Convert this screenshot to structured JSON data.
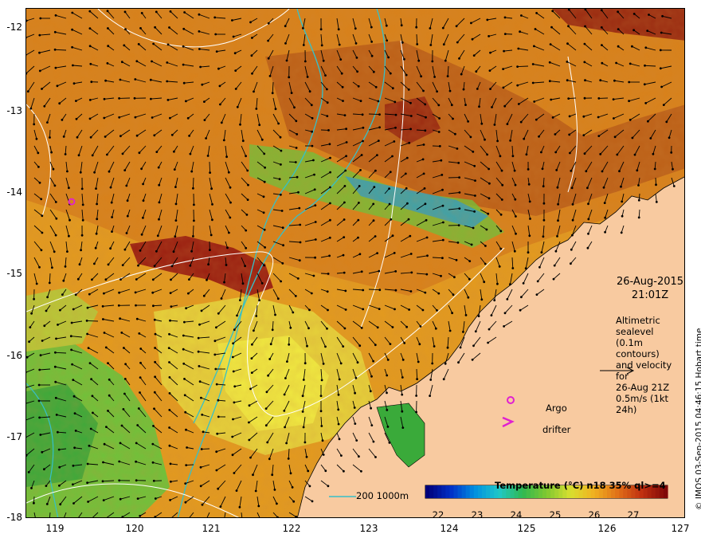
{
  "map": {
    "y_axis_labels": [
      "-12",
      "-13",
      "-14",
      "-15",
      "-16",
      "-17",
      "-18"
    ],
    "x_axis_labels": [
      "119",
      "120",
      "121",
      "122",
      "123",
      "124",
      "125",
      "126",
      "127"
    ],
    "lon_range": [
      118.6,
      127
    ],
    "lat_range": [
      -18,
      -11.75
    ]
  },
  "overlay": {
    "date": "26-Aug-2015",
    "time": "21:01Z",
    "altimetry_lines": [
      "Altimetric sealevel",
      "(0.1m contours)",
      "and velocity for",
      "26-Aug 21Z",
      "0.5m/s (1kt 24h)"
    ],
    "argo_label": "Argo",
    "drifter_label": "drifter",
    "depth_label": "200  1000m",
    "credit": "© IMOS 03-Sep-2015 04:46:15 Hobart time"
  },
  "legend": {
    "title": "Temperature (°C) n18 35% ql>=4",
    "ticks": [
      "22",
      "23",
      "24",
      "25",
      "26",
      "27"
    ],
    "range": [
      21.7,
      27.9
    ]
  },
  "colors": {
    "land": "#f8caa0",
    "warm": "#e39a1e",
    "hot": "#a33212",
    "cool": "#3aaa3a",
    "yellow": "#e6e23a",
    "bathymetry": "#36c0c8",
    "contour": "#ffffff",
    "argo": "#e020d0"
  }
}
